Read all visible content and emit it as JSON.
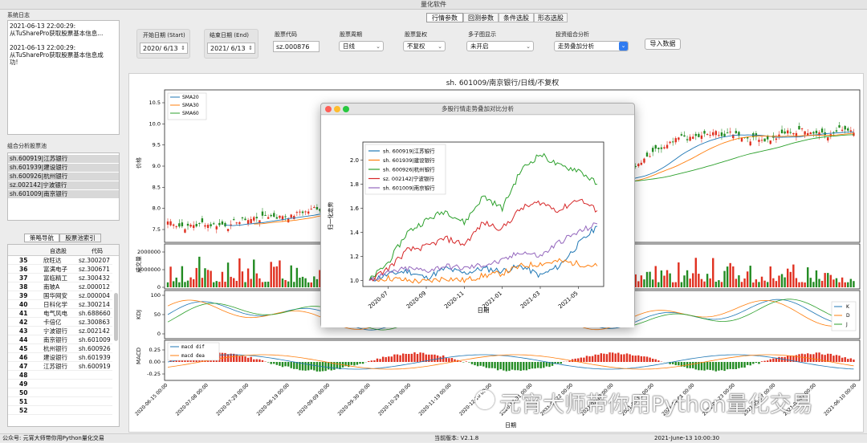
{
  "window": {
    "title": "量化软件"
  },
  "tabs": [
    {
      "label": "行情参数",
      "active": true
    },
    {
      "label": "回测参数",
      "active": false
    },
    {
      "label": "条件选股",
      "active": false
    },
    {
      "label": "形态选股",
      "active": false
    }
  ],
  "log": {
    "title": "系统日志",
    "entries": [
      {
        "time": "2021-06-13 22:00:29:",
        "msg1": "从TuShare​Pro获取股票基本信息...",
        "msg2": ""
      },
      {
        "time": "2021-06-13 22:00:29:",
        "msg1": "从TuShare​Pro获取股票基本信息成",
        "msg2": "功!"
      }
    ]
  },
  "pool": {
    "title": "组合分析股票池",
    "items": [
      "sh.600919|江苏银行",
      "sh.601939|建设银行",
      "sh.600926|杭州银行",
      "sz.002142|宁波银行",
      "sh.601009|南京银行"
    ]
  },
  "nav": {
    "tab1": "策略导航",
    "tab2": "股票池索引",
    "col_name": "自选股",
    "col_code": "代码",
    "rows": [
      {
        "n": "35",
        "name": "欣旺达",
        "code": "sz.300207"
      },
      {
        "n": "36",
        "name": "富满电子",
        "code": "sz.300671"
      },
      {
        "n": "37",
        "name": "富临精工",
        "code": "sz.300432"
      },
      {
        "n": "38",
        "name": "南玻A",
        "code": "sz.000012"
      },
      {
        "n": "39",
        "name": "国华网安",
        "code": "sz.000004"
      },
      {
        "n": "40",
        "name": "日科化学",
        "code": "sz.300214"
      },
      {
        "n": "41",
        "name": "电气风电",
        "code": "sh.688660"
      },
      {
        "n": "42",
        "name": "卡倍亿",
        "code": "sz.300863"
      },
      {
        "n": "43",
        "name": "宁波银行",
        "code": "sz.002142"
      },
      {
        "n": "44",
        "name": "南京银行",
        "code": "sh.601009"
      },
      {
        "n": "45",
        "name": "杭州银行",
        "code": "sh.600926"
      },
      {
        "n": "46",
        "name": "建设银行",
        "code": "sh.601939"
      },
      {
        "n": "47",
        "name": "江苏银行",
        "code": "sh.600919"
      },
      {
        "n": "48",
        "name": "",
        "code": ""
      },
      {
        "n": "49",
        "name": "",
        "code": ""
      },
      {
        "n": "50",
        "name": "",
        "code": ""
      },
      {
        "n": "51",
        "name": "",
        "code": ""
      },
      {
        "n": "52",
        "name": "",
        "code": ""
      }
    ]
  },
  "params": {
    "start_label": "开始日期 (Start)",
    "start_value": "2020/ 6/13",
    "end_label": "结束日期 (End)",
    "end_value": "2021/ 6/13",
    "code_label": "股票代码",
    "code_value": "sz.000876",
    "period_label": "股票周期",
    "period_value": "日线",
    "adjust_label": "股票复权",
    "adjust_value": "不复权",
    "subplot_label": "多子图显示",
    "subplot_value": "未开启",
    "combo_label": "投资组合分析",
    "combo_value": "走势叠加分析",
    "import_button": "导入数据"
  },
  "main_chart": {
    "title": "sh. 601009/南京银行/日线/不复权",
    "price_ylabel": "价格",
    "price_ticks": [
      "10.5",
      "10.0",
      "9.5",
      "9.0",
      "8.5",
      "8.0",
      "7.5"
    ],
    "legend_ma": [
      "SMA20",
      "SMA30",
      "SMA60"
    ],
    "vol_ylabel": "成交量",
    "vol_ticks": [
      "2000000",
      "1000000",
      "0"
    ],
    "kdj_ylabel": "KDJ",
    "kdj_ticks": [
      "100",
      "50",
      "0"
    ],
    "kdj_legend": [
      "K",
      "D",
      "J"
    ],
    "macd_ylabel": "MACD",
    "macd_ticks": [
      "0.25",
      "0.00",
      "-0.25"
    ],
    "macd_legend": [
      "macd dif",
      "macd dea"
    ],
    "x_dates": [
      "2020-06-15 00:00",
      "2020-07-08 00:00",
      "2020-07-29 00:00",
      "2020-08-19 00:00",
      "2020-09-09 00:00",
      "2020-09-30 00:00",
      "2020-10-29 00:00",
      "2020-11-19 00:00",
      "2020-12-10 00:00",
      "2020-12-31 00:00",
      "2021-01-22 00:00",
      "2021-02-18 00:00",
      "2021-03-11 00:00",
      "2021-04-01 00:00",
      "2021-04-23 00:00",
      "2021-05-17 00:00",
      "2021-06-07 00:00",
      "2021-06-10 00:00"
    ],
    "xlabel": "日期"
  },
  "popup": {
    "title": "多股行情走势叠加对比分析",
    "ylabel": "归一化走势",
    "xlabel": "日期",
    "chart_data": {
      "type": "line",
      "title": "",
      "xlabel": "日期",
      "ylabel": "归一化走势",
      "x": [
        "2020-06",
        "2020-07",
        "2020-08",
        "2020-09",
        "2020-10",
        "2020-11",
        "2020-12",
        "2021-01",
        "2021-02",
        "2021-03",
        "2021-04",
        "2021-05",
        "2021-06"
      ],
      "xticks": [
        "2020-07",
        "2020-09",
        "2020-11",
        "2021-01",
        "2021-03",
        "2021-05"
      ],
      "yticks": [
        "2.0",
        "1.8",
        "1.6",
        "1.4",
        "1.2",
        "1.0"
      ],
      "ylim": [
        0.95,
        2.15
      ],
      "legend_position": "top-left",
      "series": [
        {
          "name": "sh. 600919|江苏银行",
          "color": "#1f77b4",
          "values": [
            1.0,
            1.05,
            1.08,
            1.02,
            1.1,
            1.06,
            1.1,
            1.08,
            1.12,
            1.04,
            1.12,
            1.3,
            1.45
          ]
        },
        {
          "name": "sh. 601939|建设银行",
          "color": "#ff7f0e",
          "values": [
            1.0,
            1.02,
            1.0,
            0.99,
            1.02,
            1.0,
            1.04,
            1.06,
            1.12,
            1.14,
            1.16,
            1.14,
            1.12
          ]
        },
        {
          "name": "sh. 600926|杭州银行",
          "color": "#2ca02c",
          "values": [
            1.0,
            1.15,
            1.4,
            1.5,
            1.58,
            1.48,
            1.7,
            1.6,
            1.92,
            2.05,
            1.95,
            1.92,
            1.8
          ]
        },
        {
          "name": "sz. 002142|宁波银行",
          "color": "#d62728",
          "values": [
            1.0,
            1.1,
            1.25,
            1.28,
            1.35,
            1.3,
            1.48,
            1.43,
            1.6,
            1.65,
            1.58,
            1.68,
            1.58
          ]
        },
        {
          "name": "sh. 601009|南京银行",
          "color": "#9467bd",
          "values": [
            1.0,
            1.06,
            1.1,
            1.08,
            1.12,
            1.1,
            1.13,
            1.16,
            1.24,
            1.2,
            1.32,
            1.4,
            1.47
          ]
        }
      ]
    }
  },
  "status": {
    "left": "公众号: 元宵大师带你用Python量化交易",
    "version": "当前版本: V2.1.8",
    "time": "2021-June-13 10:00:30"
  },
  "watermark": "元宵大师带你用Python量化交易"
}
